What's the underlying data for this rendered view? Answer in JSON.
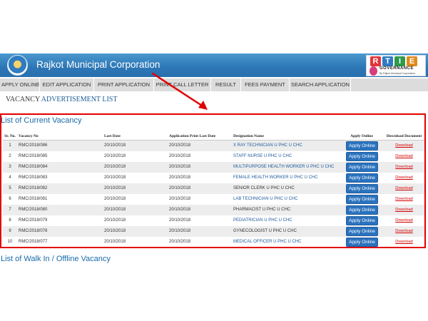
{
  "header": {
    "title": "Rajkot Municipal Corporation",
    "logo_name": "rmc-logo",
    "rtie_letters": [
      "R",
      "T",
      "I",
      "E"
    ],
    "rtie_letter_colors": [
      "#e2343a",
      "#2e7bc4",
      "#2d9a4a",
      "#e08a1c"
    ],
    "rtie_sub": "GOVERNANCE",
    "rtie_sub2": "By Rajkot Municipal Corporation"
  },
  "nav": {
    "items": [
      "APPLY ONLINE",
      "EDIT APPLICATION",
      "PRINT APPLICATION",
      "PRINT CALL LETTER",
      "RESULT",
      "FEES PAYMENT",
      "SEARCH APPLICATION"
    ]
  },
  "section": {
    "title_part1": "VACANCY ",
    "title_part2": "ADVERTISEMENT LIST"
  },
  "current_list": {
    "title": "List of Current Vacancy",
    "headers": [
      "Sr. No.",
      "Vacancy No",
      "Last Date",
      "Application Print Last Date",
      "Designation Name",
      "Apply Online",
      "Download Document"
    ],
    "button_label": "Apply Online",
    "download_label": "Download",
    "rows": [
      {
        "sr": "1",
        "vacancy": "RMC/2018/086",
        "last": "20/10/2018",
        "print_last": "20/10/2018",
        "designation": "X RAY TECHNICIAN U PHC U CHC"
      },
      {
        "sr": "2",
        "vacancy": "RMC/2018/085",
        "last": "20/10/2018",
        "print_last": "20/10/2018",
        "designation": "STAFF NURSE U PHC U CHC"
      },
      {
        "sr": "3",
        "vacancy": "RMC/2018/084",
        "last": "20/10/2018",
        "print_last": "20/10/2018",
        "designation": "MULTIPURPOSE HEALTH WORKER U PHC U CHC"
      },
      {
        "sr": "4",
        "vacancy": "RMC/2018/083",
        "last": "20/10/2018",
        "print_last": "20/10/2018",
        "designation": "FEMALE HEALTH WORKER U PHC U CHC"
      },
      {
        "sr": "5",
        "vacancy": "RMC/2018/082",
        "last": "20/10/2018",
        "print_last": "20/10/2018",
        "designation": "SENIOR CLERK U PHC U CHC"
      },
      {
        "sr": "6",
        "vacancy": "RMC/2018/081",
        "last": "20/10/2018",
        "print_last": "20/10/2018",
        "designation": "LAB TECHNICIAN U PHC U CHC"
      },
      {
        "sr": "7",
        "vacancy": "RMC/2018/080",
        "last": "20/10/2018",
        "print_last": "20/10/2018",
        "designation": "PHARMACIST U PHC U CHC"
      },
      {
        "sr": "8",
        "vacancy": "RMC/2018/079",
        "last": "20/10/2018",
        "print_last": "20/10/2018",
        "designation": "PEDIATRICIAN U PHC U CHC"
      },
      {
        "sr": "9",
        "vacancy": "RMC/2018/078",
        "last": "20/10/2018",
        "print_last": "20/10/2018",
        "designation": "GYNECOLOGIST U PHC U CHC"
      },
      {
        "sr": "10",
        "vacancy": "RMC/2018/077",
        "last": "20/10/2018",
        "print_last": "20/10/2018",
        "designation": "MEDICAL OFFICER U PHC U CHC"
      }
    ]
  },
  "walkin_list": {
    "title": "List of Walk In / Offline Vacancy"
  },
  "colors": {
    "highlight_red": "#e10000",
    "header_blue": "#2c76b5",
    "button_blue": "#2b72bd",
    "link_blue": "#1f5a9b",
    "download_red": "#d40000"
  }
}
